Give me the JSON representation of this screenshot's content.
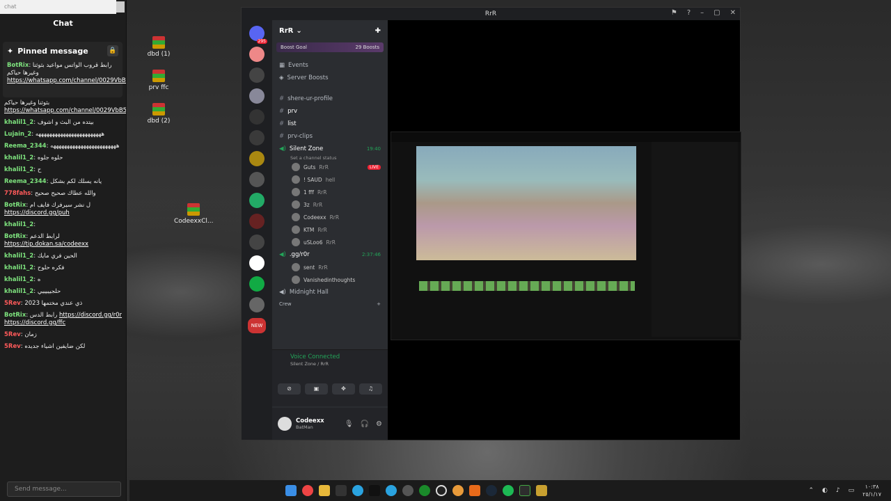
{
  "chat_panel": {
    "search_placeholder": "chat",
    "title": "Chat",
    "pinned_label": "Pinned message",
    "send_placeholder": "Send message...",
    "messages": [
      {
        "user": "BotRix",
        "color": "#7ee37e",
        "text": "رابط قروب الواتس مواعيد بثوثنا وغيرها حياكم ",
        "link": "https://whatsapp.com/channel/0029VbB5W1hJP20w9pY9hN34"
      },
      {
        "user": "",
        "color": "#ffffff",
        "text": "بثوثنا وغيرها حياكم ",
        "link": "https://whatsapp.com/channel/0029VbB5W1hJP20w9pY9hN34"
      },
      {
        "user": "khalil1_2",
        "color": "#7ee37e",
        "text": "بيتده من البث و اشوف",
        "link": ""
      },
      {
        "user": "Lujain_2",
        "color": "#7ee37e",
        "text": "ههههههههههههههههههههههههه",
        "link": ""
      },
      {
        "user": "Reema_2344",
        "color": "#7ee37e",
        "text": "ههههههههههههههههههههههههه",
        "link": ""
      },
      {
        "user": "khalil1_2",
        "color": "#7ee37e",
        "text": "حلوه جلوه",
        "link": ""
      },
      {
        "user": "khalil1_2",
        "color": "#7ee37e",
        "text": "ح",
        "link": ""
      },
      {
        "user": "Reema_2344",
        "color": "#7ee37e",
        "text": "يانه يسلك لكم بشكل",
        "link": ""
      },
      {
        "user": "778fahs",
        "color": "#ff5a5a",
        "text": "والله عطاك صحيح صحيح",
        "link": ""
      },
      {
        "user": "BotRix",
        "color": "#7ee37e",
        "text": "ل نشر سيرفرك فايف ام ",
        "link": "https://discord.gg/puh"
      },
      {
        "user": "khalil1_2",
        "color": "#7ee37e",
        "text": "",
        "link": ""
      },
      {
        "user": "BotRix",
        "color": "#7ee37e",
        "text": "لرابط الدعم ",
        "link": "https://tip.dokan.sa/codeexx"
      },
      {
        "user": "khalil1_2",
        "color": "#7ee37e",
        "text": "الحين فري مايك",
        "link": ""
      },
      {
        "user": "khalil1_2",
        "color": "#7ee37e",
        "text": "فكره حلوح",
        "link": ""
      },
      {
        "user": "khalil1_2",
        "color": "#7ee37e",
        "text": "ه",
        "link": ""
      },
      {
        "user": "khalil1_2",
        "color": "#7ee37e",
        "text": "حلجيييييي",
        "link": ""
      },
      {
        "user": "5Rev",
        "color": "#ff5a5a",
        "text": "ذي عندي مختمها 2023",
        "link": ""
      },
      {
        "user": "BotRix",
        "color": "#7ee37e",
        "text": "رابط الدس ",
        "link": "https://discord.gg/r0r  https://discord.gg/ffc"
      },
      {
        "user": "5Rev",
        "color": "#ff5a5a",
        "text": "زمان",
        "link": ""
      },
      {
        "user": "5Rev",
        "color": "#ff5a5a",
        "text": "لكن ضايفين اشياء جديده",
        "link": ""
      }
    ]
  },
  "desktop_icons": [
    "dbd (1)",
    "prv ffc",
    "dbd (2)",
    "CodeexxCl..."
  ],
  "discord": {
    "window_title": "RrR",
    "server_name": "RrR",
    "boost_goal": "Boost Goal",
    "boosts": "29 Boosts",
    "badges": {
      "top": "295",
      "new": "NEW"
    },
    "menu": [
      "Events",
      "Server Boosts"
    ],
    "channels": [
      "shere-ur-profile",
      "prv",
      "list",
      "prv-clips"
    ],
    "voice_channel": {
      "name": "Silent Zone",
      "time": "19:40",
      "status": "Set a channel status"
    },
    "voice_users": [
      {
        "name": "Guts",
        "tag": "RrR",
        "live": "LIVE"
      },
      {
        "name": "! SAUD",
        "tag": "hell",
        "live": ""
      },
      {
        "name": "1 fff",
        "tag": "RrR",
        "live": ""
      },
      {
        "name": "3z",
        "tag": "RrR",
        "live": ""
      },
      {
        "name": "Codeexx",
        "tag": "RrR",
        "live": ""
      },
      {
        "name": "KTM",
        "tag": "RrR",
        "live": ""
      },
      {
        "name": "uSLoo6",
        "tag": "RrR",
        "live": ""
      }
    ],
    "voice_channel2": {
      "name": ".gg/r0r",
      "time": "2:37:46"
    },
    "voice_users2": [
      {
        "name": "sent",
        "tag": "RrR"
      },
      {
        "name": "Vanishedinthoughts",
        "tag": ""
      }
    ],
    "other_channels": [
      "Midnight Hall",
      "Crew"
    ],
    "voice_connected": "Voice Connected",
    "voice_location": "Silent Zone / RrR",
    "username": "Codeexx",
    "user_status": "BatMan"
  },
  "taskbar": {
    "clock_time": "١٠:٣٨",
    "clock_date": "٢٥/١/١٧"
  }
}
